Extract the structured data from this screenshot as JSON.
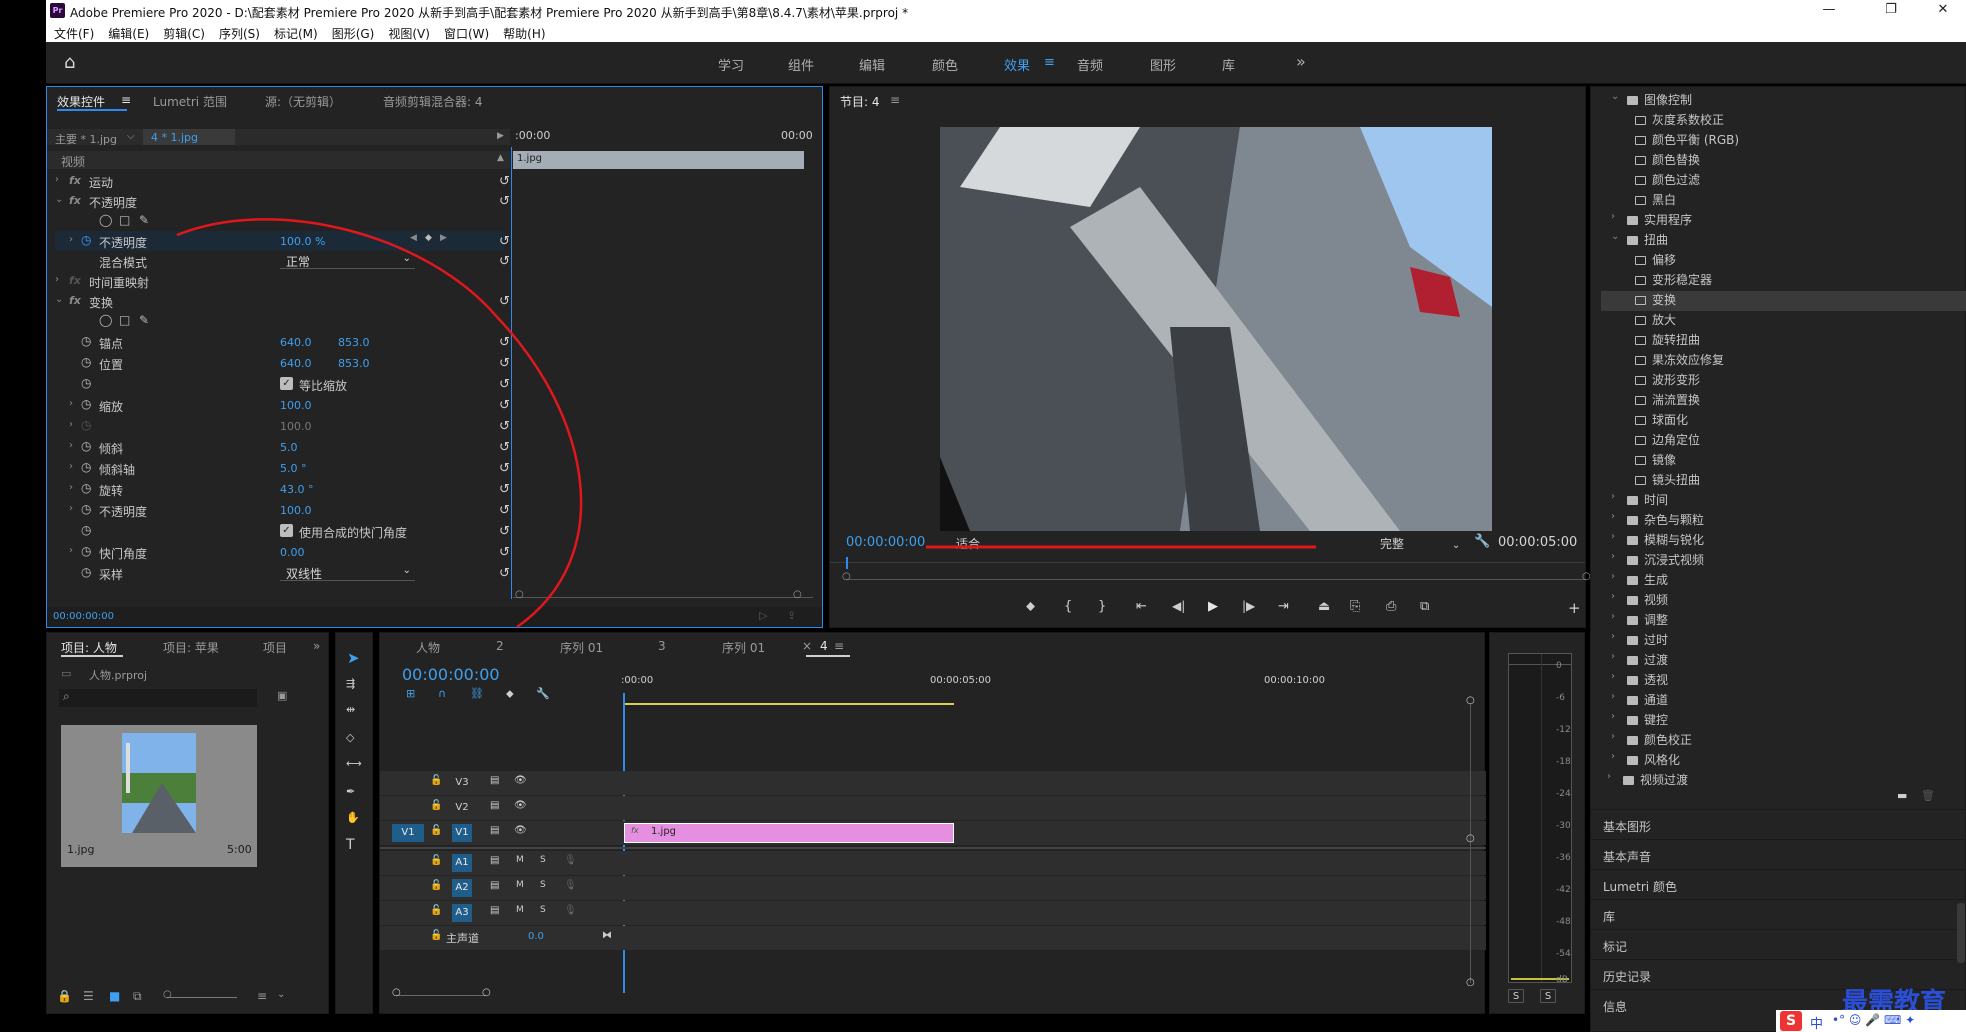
{
  "titlebar": {
    "title": "Adobe Premiere Pro 2020 - D:\\配套素材 Premiere Pro 2020 从新手到高手\\配套素材 Premiere Pro 2020 从新手到高手\\第8章\\8.4.7\\素材\\苹果.prproj *",
    "app_icon": "Pr",
    "minimize": "—",
    "restore": "❐",
    "close": "✕"
  },
  "menu": [
    "文件(F)",
    "编辑(E)",
    "剪辑(C)",
    "序列(S)",
    "标记(M)",
    "图形(G)",
    "视图(V)",
    "窗口(W)",
    "帮助(H)"
  ],
  "workspaces": {
    "home_icon": "home-icon",
    "items": [
      "学习",
      "组件",
      "编辑",
      "颜色",
      "效果",
      "音频",
      "图形",
      "库"
    ],
    "active": "效果",
    "menu_icon": "≡",
    "more": "»"
  },
  "effect_controls": {
    "tabs": [
      "效果控件",
      "Lumetri 范围",
      "源:（无剪辑）",
      "音频剪辑混合器: 4"
    ],
    "tab_menu": "≡",
    "master_clip": "主要 * 1.jpg",
    "seq_clip": "4 * 1.jpg",
    "time_start": ":00:00",
    "time_end": "00:00",
    "clip_bar_label": "1.jpg",
    "section_video": "视频",
    "motion": "运动",
    "opacity": "不透明度",
    "opacity_prop": "不透明度",
    "opacity_value": "100.0 %",
    "blend_mode": "混合模式",
    "blend_value": "正常",
    "time_remap": "时间重映射",
    "transform": "变换",
    "anchor": "锚点",
    "anchor_x": "640.0",
    "anchor_y": "853.0",
    "position": "位置",
    "position_x": "640.0",
    "position_y": "853.0",
    "uniform_scale": "等比缩放",
    "scale": "缩放",
    "scale_value": "100.0",
    "scale_width_value": "100.0",
    "skew": "倾斜",
    "skew_value": "5.0",
    "skew_axis": "倾斜轴",
    "skew_axis_value": "5.0 °",
    "rotation": "旋转",
    "rotation_value": "43.0 °",
    "opacity2": "不透明度",
    "opacity2_value": "100.0",
    "use_comp_shutter": "使用合成的快门角度",
    "shutter_angle": "快门角度",
    "shutter_value": "0.00",
    "sampling": "采样",
    "sampling_value": "双线性",
    "footer_time": "00:00:00:00"
  },
  "program": {
    "tab": "节目: 4",
    "tab_menu": "≡",
    "timecode": "00:00:00:00",
    "fit": "适合",
    "quality": "完整",
    "duration": "00:00:05:00"
  },
  "project": {
    "tabs": [
      "项目: 人物",
      "项目: 苹果",
      "项目"
    ],
    "more": "»",
    "file": "人物.prproj",
    "item_name": "1.jpg",
    "item_duration": "5:00"
  },
  "timeline": {
    "tabs": [
      "人物",
      "2",
      "序列 01",
      "3",
      "序列 01",
      "4"
    ],
    "close": "×",
    "tab_menu": "≡",
    "timecode": "00:00:00:00",
    "ruler": [
      ":00:00",
      "00:00:05:00",
      "00:00:10:00"
    ],
    "tracks_video": [
      "V3",
      "V2",
      "V1"
    ],
    "source_v1": "V1",
    "tracks_audio": [
      "A1",
      "A2",
      "A3"
    ],
    "mute": "M",
    "solo": "S",
    "master": "主声道",
    "master_value": "0.0",
    "clip": "1.jpg",
    "fx_badge": "fx"
  },
  "meter": {
    "ticks": [
      "0",
      "-6",
      "-12",
      "-18",
      "-24",
      "-30",
      "-36",
      "-42",
      "-48",
      "-54",
      "dB"
    ],
    "solo_left": "S",
    "solo_right": "S"
  },
  "effects_tree": {
    "items": [
      {
        "label": "图像控制",
        "level": 1,
        "folder": true,
        "open": true
      },
      {
        "label": "灰度系数校正",
        "level": 2
      },
      {
        "label": "颜色平衡 (RGB)",
        "level": 2
      },
      {
        "label": "颜色替换",
        "level": 2
      },
      {
        "label": "颜色过滤",
        "level": 2
      },
      {
        "label": "黑白",
        "level": 2
      },
      {
        "label": "实用程序",
        "level": 1,
        "folder": true
      },
      {
        "label": "扭曲",
        "level": 1,
        "folder": true,
        "open": true
      },
      {
        "label": "偏移",
        "level": 2
      },
      {
        "label": "变形稳定器",
        "level": 2
      },
      {
        "label": "变换",
        "level": 2,
        "selected": true
      },
      {
        "label": "放大",
        "level": 2
      },
      {
        "label": "旋转扭曲",
        "level": 2
      },
      {
        "label": "果冻效应修复",
        "level": 2
      },
      {
        "label": "波形变形",
        "level": 2
      },
      {
        "label": "湍流置换",
        "level": 2
      },
      {
        "label": "球面化",
        "level": 2
      },
      {
        "label": "边角定位",
        "level": 2
      },
      {
        "label": "镜像",
        "level": 2
      },
      {
        "label": "镜头扭曲",
        "level": 2
      },
      {
        "label": "时间",
        "level": 1,
        "folder": true
      },
      {
        "label": "杂色与颗粒",
        "level": 1,
        "folder": true
      },
      {
        "label": "模糊与锐化",
        "level": 1,
        "folder": true
      },
      {
        "label": "沉浸式视频",
        "level": 1,
        "folder": true
      },
      {
        "label": "生成",
        "level": 1,
        "folder": true
      },
      {
        "label": "视频",
        "level": 1,
        "folder": true
      },
      {
        "label": "调整",
        "level": 1,
        "folder": true
      },
      {
        "label": "过时",
        "level": 1,
        "folder": true
      },
      {
        "label": "过渡",
        "level": 1,
        "folder": true
      },
      {
        "label": "透视",
        "level": 1,
        "folder": true
      },
      {
        "label": "通道",
        "level": 1,
        "folder": true
      },
      {
        "label": "键控",
        "level": 1,
        "folder": true
      },
      {
        "label": "颜色校正",
        "level": 1,
        "folder": true
      },
      {
        "label": "风格化",
        "level": 1,
        "folder": true
      },
      {
        "label": "视频过渡",
        "level": 0,
        "folder": true
      }
    ],
    "sections": [
      "基本图形",
      "基本声音",
      "Lumetri 颜色",
      "库",
      "标记",
      "历史记录",
      "信息"
    ]
  },
  "watermark": {
    "text": "最需教育",
    "ime": "中"
  },
  "colors": {
    "accent": "#3ea0ef",
    "annotation": "#e0171d",
    "clip_pink": "#e58fe0",
    "panel": "#232323",
    "video_bg": "#8fb7e3"
  }
}
